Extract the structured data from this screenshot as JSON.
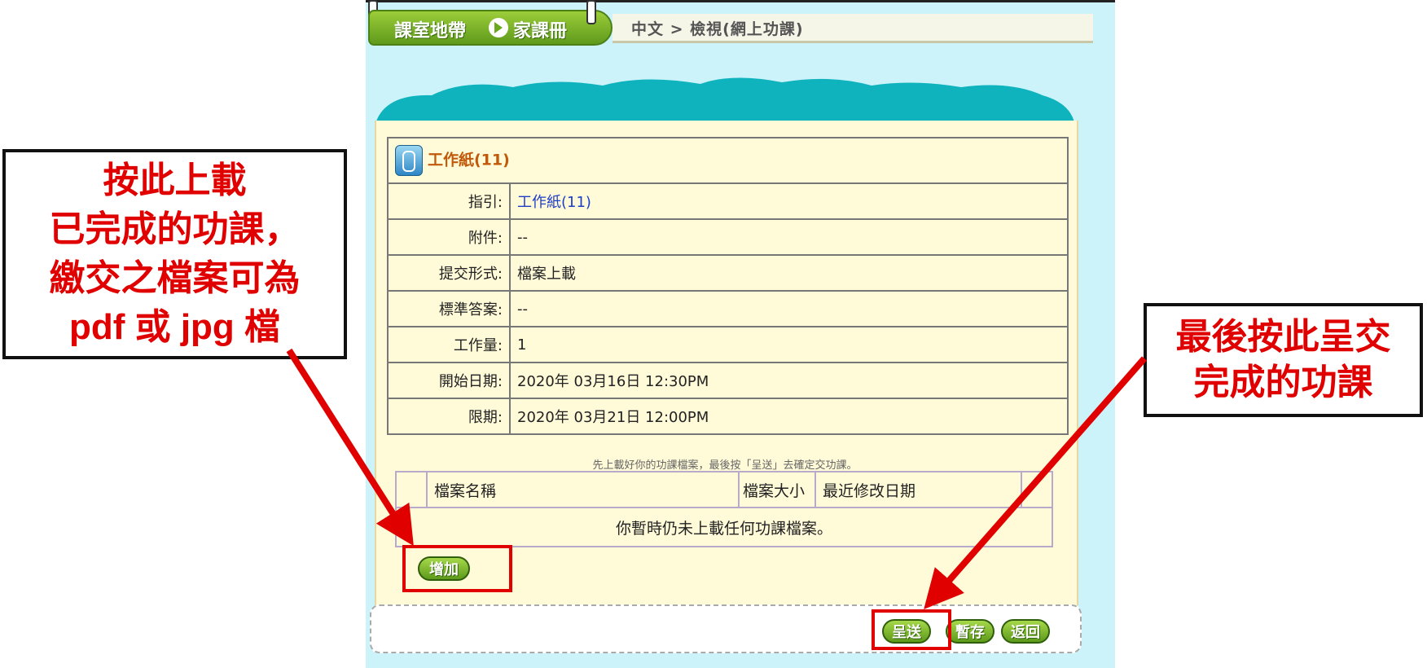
{
  "header": {
    "tab_classroom": "課室地帶",
    "tab_homework": "家課冊",
    "breadcrumb": "中文 > 檢視(網上功課)"
  },
  "assignment": {
    "title": "工作紙(11)",
    "rows": [
      {
        "label": "指引:",
        "value": "工作紙(11)",
        "link": true
      },
      {
        "label": "附件:",
        "value": "--"
      },
      {
        "label": "提交形式:",
        "value": "檔案上載"
      },
      {
        "label": "標準答案:",
        "value": "--"
      },
      {
        "label": "工作量:",
        "value": "1"
      },
      {
        "label": "開始日期:",
        "value": "2020年 03月16日 12:30PM"
      },
      {
        "label": "限期:",
        "value": "2020年 03月21日 12:00PM"
      }
    ]
  },
  "upload": {
    "hint": "先上載好你的功課檔案，最後按「呈送」去確定交功課。",
    "columns": [
      "檔案名稱",
      "檔案大小",
      "最近修改日期"
    ],
    "empty_message": "你暫時仍未上載任何功課檔案。",
    "add_button": "增加"
  },
  "footer": {
    "submit_button": "呈送",
    "save_button": "暫存",
    "back_button": "返回"
  },
  "annotations": {
    "left_lines": [
      "按此上載",
      "已完成的功課，",
      "繳交之檔案可為",
      "pdf 或 jpg 檔"
    ],
    "right_lines": [
      "最後按此呈交",
      "完成的功課"
    ]
  },
  "colors": {
    "annotation_red": "#e00000",
    "button_green": "#6aa81e",
    "panel_bg": "#ccf3fa",
    "content_bg": "#fffad8"
  }
}
